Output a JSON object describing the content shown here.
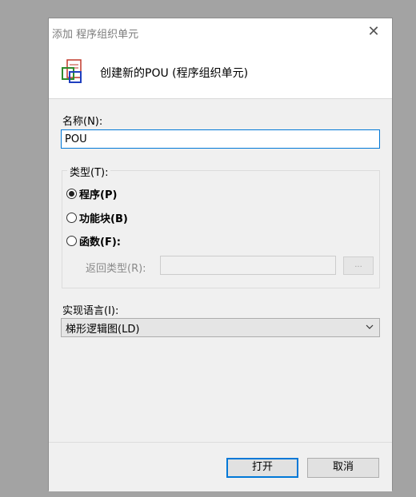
{
  "window": {
    "title": "添加 程序组织单元",
    "close_glyph": "✕"
  },
  "header": {
    "text": "创建新的POU (程序组织单元)",
    "icon": "pou-icon"
  },
  "name": {
    "label": "名称(N):",
    "value": "POU"
  },
  "type": {
    "legend": "类型(T):",
    "options": [
      {
        "label": "程序(P)",
        "checked": true
      },
      {
        "label": "功能块(B)",
        "checked": false
      },
      {
        "label": "函数(F):",
        "checked": false
      }
    ],
    "return_type_label": "返回类型(R):",
    "return_type_value": "",
    "browse_label": "..."
  },
  "language": {
    "label": "实现语言(I):",
    "selected": "梯形逻辑图(LD)"
  },
  "buttons": {
    "open": "打开",
    "cancel": "取消"
  },
  "colors": {
    "accent": "#0078d7",
    "background": "#a3a3a3",
    "dialog": "#f0f0f0"
  }
}
